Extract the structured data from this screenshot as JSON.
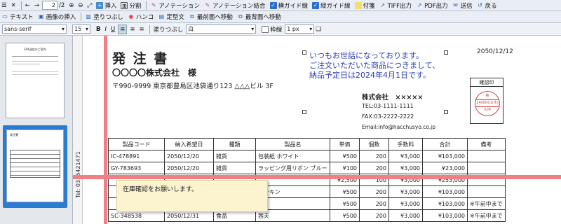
{
  "toolbar1": {
    "page_current": "2",
    "page_total": "/2",
    "insert": "挿入",
    "split": "分割",
    "annotation": "アノテーション",
    "annotation_merge": "アノテーション結合",
    "hguide": "横ガイド線",
    "vguide": "縦ガイド線",
    "sticky": "付箋",
    "tiff": "TIFF出力",
    "pdf": "PDF出力",
    "send": "送信",
    "back": "戻る"
  },
  "toolbar2": {
    "text": "テキスト",
    "image": "画像の挿入",
    "fill": "塗りつぶし",
    "stamp": "ハンコ",
    "fixed": "定型文",
    "front": "最前面へ移動",
    "back": "最背面へ移動"
  },
  "toolbar3": {
    "font": "sans-serif",
    "size": "15",
    "fill_label": "塗りつぶし",
    "fill_color": "白",
    "border_label": "枠線",
    "border_width": "1 px"
  },
  "fax": {
    "side_text": "Tel: 0356421471",
    "title": "発 注 書",
    "to": "〇〇〇〇株式会社　様",
    "address": "〒990-9999 東京都豊島区池袋通り123 △△△ビル 3F",
    "date": "2050/12/12",
    "greet1": "いつもお世話になっております。",
    "greet2": "ご注文いただいた商品につきまして、",
    "greet3": "納品予定日は2024年4月1日です。",
    "company": "株式会社　×××××",
    "tel": "TEL:03-1111-1111",
    "faxno": "FAX:03-2222-2222",
    "email": "Email:info@hacchusyo.co.jp",
    "seal_label": "確認印",
    "seal_top": "検",
    "seal_date": "24/08/01(木)",
    "seal_name": "山中"
  },
  "table": {
    "headers": [
      "製品コード",
      "納入希望日",
      "種類",
      "製品名",
      "単価",
      "個数",
      "手数料",
      "合計",
      "備考"
    ],
    "rows": [
      [
        "IC-478891",
        "2050/12/20",
        "雑貨",
        "包装紙 ホワイト",
        "¥500",
        "200",
        "¥3,000",
        "¥103,000",
        ""
      ],
      [
        "GY-783693",
        "2050/12/20",
        "雑貨",
        "ラッピング用リボン ブルー",
        "¥100",
        "200",
        "¥3,000",
        "¥23,000",
        ""
      ],
      [
        "",
        "",
        "",
        "",
        "¥2,500",
        "100",
        "¥3,000",
        "¥253,000",
        ""
      ],
      [
        "",
        "",
        "",
        "ドチキン",
        "¥500",
        "200",
        "¥3,000",
        "¥103,000",
        ""
      ],
      [
        "",
        "",
        "",
        "",
        "¥500",
        "200",
        "¥3,000",
        "¥103,000",
        "※午前中まで"
      ],
      [
        "SC-348538",
        "2050/12/31",
        "食品",
        "茜夫",
        "¥500",
        "200",
        "¥3,000",
        "¥103,000",
        "※午前中まで"
      ]
    ]
  },
  "note": "在庫確認をお願いします。",
  "thumb_lines": "FAX送信のご案内",
  "thumb_title": "発注書"
}
